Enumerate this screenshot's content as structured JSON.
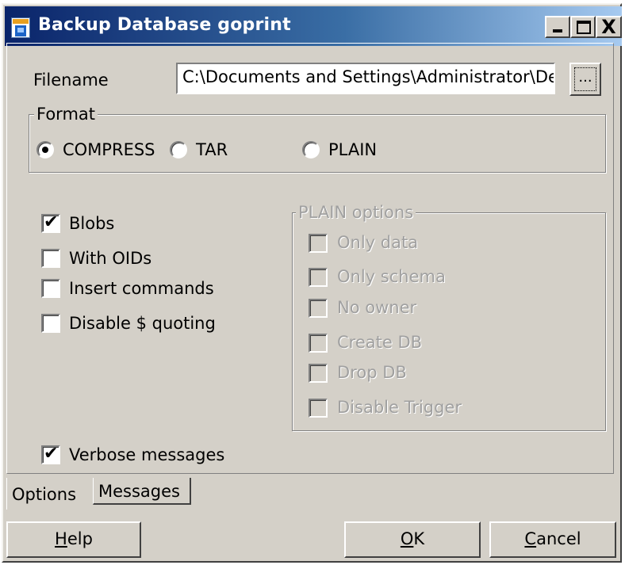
{
  "window": {
    "title": "Backup Database goprint",
    "min_glyph": "_",
    "close_glyph": "X"
  },
  "filename": {
    "label": "Filename",
    "value": "C:\\Documents and Settings\\Administrator\\De",
    "browse_label": "..."
  },
  "format": {
    "legend": "Format",
    "options": [
      {
        "label": "COMPRESS",
        "selected": true
      },
      {
        "label": "TAR",
        "selected": false
      },
      {
        "label": "PLAIN",
        "selected": false
      }
    ]
  },
  "options": [
    {
      "label": "Blobs",
      "checked": true
    },
    {
      "label": "With OIDs",
      "checked": false
    },
    {
      "label": "Insert commands",
      "checked": false
    },
    {
      "label": "Disable $ quoting",
      "checked": false
    }
  ],
  "plain_options": {
    "legend": "PLAIN options",
    "items": [
      {
        "label": "Only data",
        "checked": false
      },
      {
        "label": "Only schema",
        "checked": false
      },
      {
        "label": "No owner",
        "checked": false
      },
      {
        "label": "Create DB",
        "checked": false
      },
      {
        "label": "Drop DB",
        "checked": false
      },
      {
        "label": "Disable Trigger",
        "checked": false
      }
    ]
  },
  "verbose": {
    "label": "Verbose messages",
    "checked": true
  },
  "tabs": [
    {
      "label": "Options",
      "active": true
    },
    {
      "label": "Messages",
      "active": false
    }
  ],
  "buttons": {
    "help": {
      "mnemonic": "H",
      "rest": "elp"
    },
    "ok": {
      "mnemonic": "O",
      "rest": "K"
    },
    "cancel": {
      "mnemonic": "C",
      "rest": "ancel"
    }
  },
  "check_glyph": "✔"
}
